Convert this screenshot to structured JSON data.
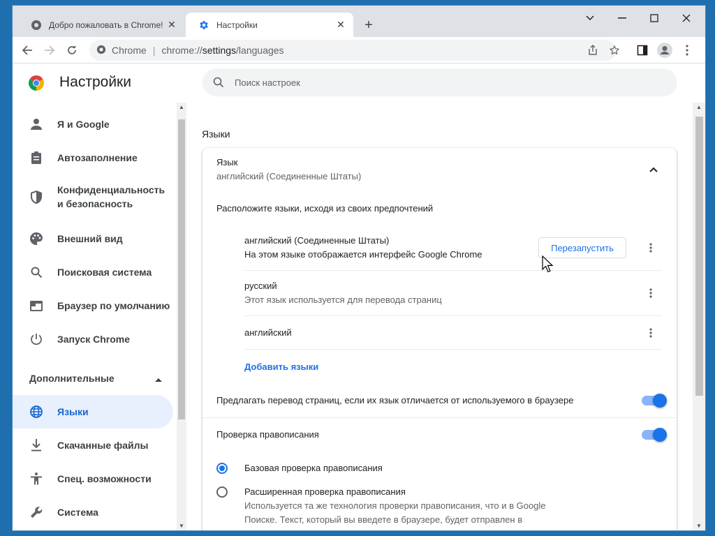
{
  "tabs": [
    {
      "title": "Добро пожаловать в Chrome!",
      "active": false
    },
    {
      "title": "Настройки",
      "active": true
    }
  ],
  "omnibox": {
    "site": "Chrome",
    "separator": "|",
    "url_scheme": "chrome://",
    "url_host": "settings",
    "url_path": "/languages"
  },
  "header": {
    "title": "Настройки",
    "search_placeholder": "Поиск настроек"
  },
  "sidebar": {
    "items": [
      {
        "label": "Я и Google",
        "icon": "person-icon"
      },
      {
        "label": "Автозаполнение",
        "icon": "clipboard-icon"
      },
      {
        "label": "Конфиденциальность и безопасность",
        "icon": "shield-icon"
      },
      {
        "label": "Внешний вид",
        "icon": "palette-icon"
      },
      {
        "label": "Поисковая система",
        "icon": "search-icon"
      },
      {
        "label": "Браузер по умолчанию",
        "icon": "browser-icon"
      },
      {
        "label": "Запуск Chrome",
        "icon": "power-icon"
      }
    ],
    "advanced_label": "Дополнительные",
    "advanced_items": [
      {
        "label": "Языки",
        "icon": "globe-icon",
        "selected": true
      },
      {
        "label": "Скачанные файлы",
        "icon": "download-icon"
      },
      {
        "label": "Спец. возможности",
        "icon": "accessibility-icon"
      },
      {
        "label": "Система",
        "icon": "wrench-icon"
      }
    ]
  },
  "main": {
    "section_title": "Языки",
    "language_header": {
      "title": "Язык",
      "value": "английский (Соединенные Штаты)"
    },
    "order_hint": "Расположите языки, исходя из своих предпочтений",
    "languages": [
      {
        "name": "английский (Соединенные Штаты)",
        "desc": "На этом языке отображается интерфейс Google Chrome"
      },
      {
        "name": "русский",
        "desc": "Этот язык используется для перевода страниц"
      },
      {
        "name": "английский",
        "desc": ""
      }
    ],
    "restart_label": "Перезапустить",
    "add_languages_label": "Добавить языки",
    "offer_translate_label": "Предлагать перевод страниц, если их язык отличается от используемого в браузере",
    "offer_translate_on": true,
    "spellcheck_label": "Проверка правописания",
    "spellcheck_on": true,
    "spell_basic_label": "Базовая проверка правописания",
    "spell_basic_selected": true,
    "spell_enhanced_label": "Расширенная проверка правописания",
    "spell_enhanced_desc_1": "Используется та же технология проверки правописания, что и в Google",
    "spell_enhanced_desc_2": "Поиске. Текст, который вы введете в браузере, будет отправлен в"
  },
  "colors": {
    "accent": "#1a73e8",
    "selected_bg": "#e8f0fe",
    "tabstrip": "#dee1e6",
    "desktop": "#1f6fae"
  }
}
